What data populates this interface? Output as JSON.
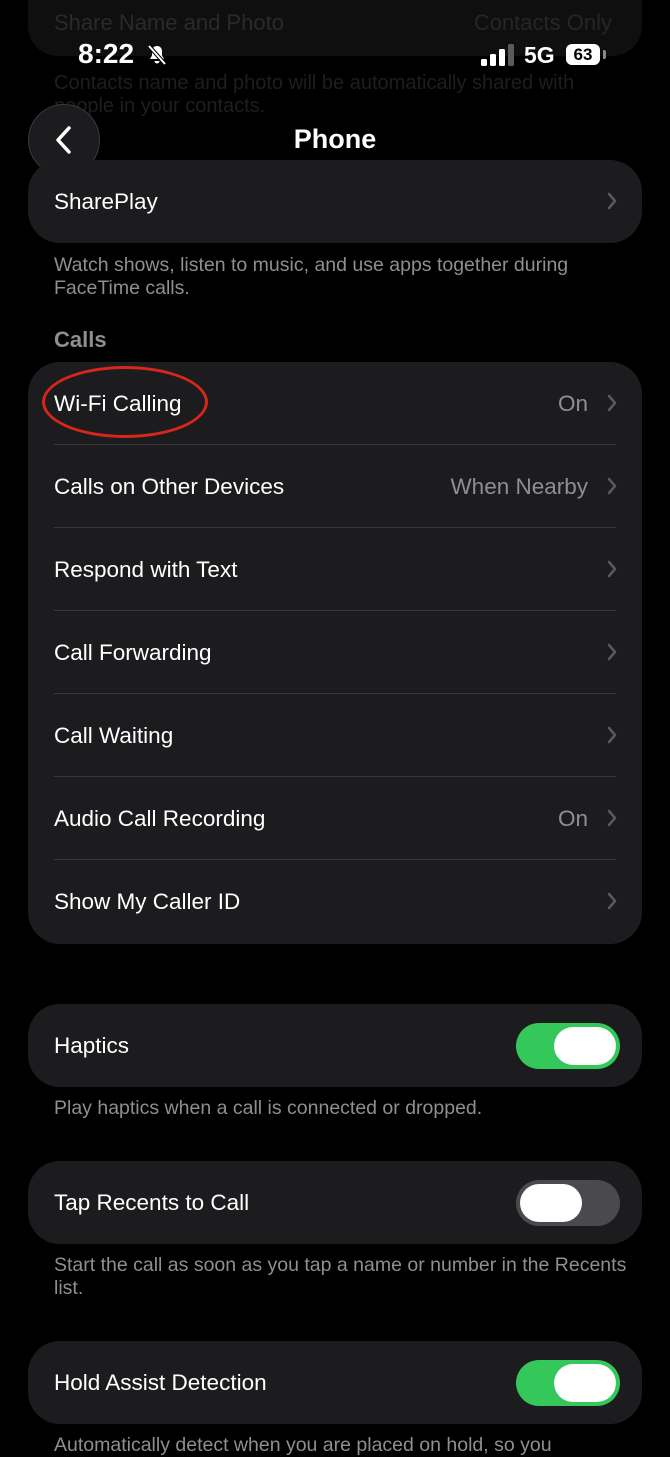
{
  "background_section": {
    "label": "Share Name and Photo",
    "value": "Contacts Only",
    "description": "Contacts name and photo will be automatically shared with people in your contacts."
  },
  "status_bar": {
    "time": "8:22",
    "network": "5G",
    "battery": "63"
  },
  "nav": {
    "title": "Phone",
    "back_icon": "chevron-left-icon"
  },
  "shareplay": {
    "label": "SharePlay",
    "description": "Watch shows, listen to music, and use apps together during FaceTime calls."
  },
  "calls": {
    "header": "Calls",
    "rows": [
      {
        "label": "Wi-Fi Calling",
        "value": "On"
      },
      {
        "label": "Calls on Other Devices",
        "value": "When Nearby"
      },
      {
        "label": "Respond with Text",
        "value": ""
      },
      {
        "label": "Call Forwarding",
        "value": ""
      },
      {
        "label": "Call Waiting",
        "value": ""
      },
      {
        "label": "Audio Call Recording",
        "value": "On"
      },
      {
        "label": "Show My Caller ID",
        "value": ""
      }
    ]
  },
  "haptics": {
    "label": "Haptics",
    "on": true,
    "description": "Play haptics when a call is connected or dropped."
  },
  "tap_recents": {
    "label": "Tap Recents to Call",
    "on": false,
    "description": "Start the call as soon as you tap a name or number in the Recents list."
  },
  "hold_assist": {
    "label": "Hold Assist Detection",
    "on": true,
    "description": "Automatically detect when you are placed on hold, so you"
  },
  "colors": {
    "toggle_on": "#34c759",
    "annotation": "#d9261c"
  }
}
